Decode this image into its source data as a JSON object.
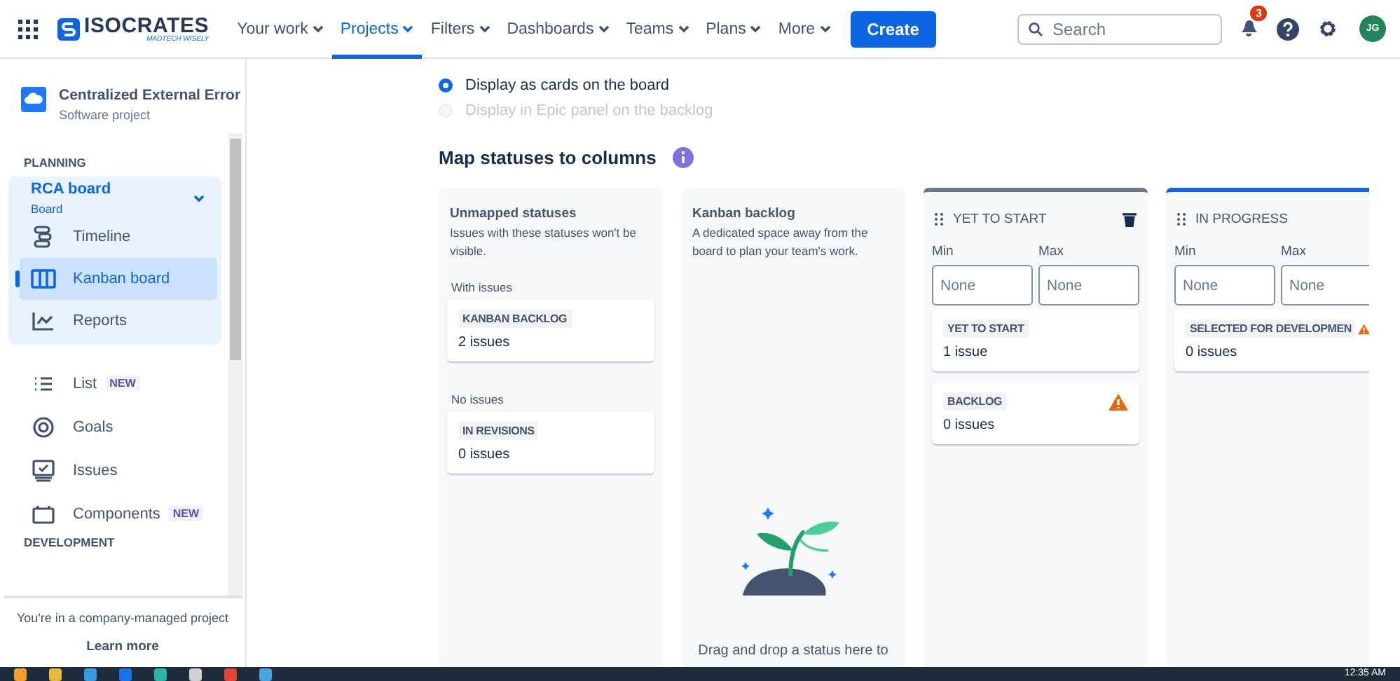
{
  "topbar": {
    "logo": {
      "name": "ISOCRATES",
      "tagline": "MADTECH WISELY"
    },
    "nav": [
      {
        "label": "Your work",
        "selected": false
      },
      {
        "label": "Projects",
        "selected": true
      },
      {
        "label": "Filters",
        "selected": false
      },
      {
        "label": "Dashboards",
        "selected": false
      },
      {
        "label": "Teams",
        "selected": false
      },
      {
        "label": "Plans",
        "selected": false
      },
      {
        "label": "More",
        "selected": false
      }
    ],
    "create_button": "Create",
    "search": {
      "placeholder": "Search"
    },
    "notifications": {
      "count": "3"
    },
    "avatar": "JG"
  },
  "sidebar": {
    "project": {
      "name": "Centralized External Error",
      "type": "Software project"
    },
    "sections": [
      {
        "title": "PLANNING",
        "items": [
          {
            "kind": "group",
            "label": "RCA board",
            "sublabel": "Board",
            "expanded": true,
            "children": [
              {
                "label": "Timeline",
                "selected": false
              },
              {
                "label": "Kanban board",
                "selected": true
              },
              {
                "label": "Reports",
                "selected": false
              }
            ]
          },
          {
            "kind": "item",
            "label": "List",
            "badge": "NEW"
          },
          {
            "kind": "item",
            "label": "Goals"
          },
          {
            "kind": "item",
            "label": "Issues"
          },
          {
            "kind": "item",
            "label": "Components",
            "badge": "NEW"
          }
        ]
      },
      {
        "title": "DEVELOPMENT"
      }
    ],
    "footer": {
      "text": "You're in a company-managed project",
      "link": "Learn more"
    }
  },
  "display_options": [
    {
      "label": "Display as cards on the board",
      "selected": true,
      "disabled": false
    },
    {
      "label": "Display in Epic panel on the backlog",
      "selected": false,
      "disabled": true
    }
  ],
  "board": {
    "title": "Map statuses to columns",
    "columns": [
      {
        "kind": "unmapped",
        "title": "Unmapped statuses",
        "description": "Issues with these statuses won't be visible.",
        "groups": [
          {
            "label": "With issues",
            "statuses": [
              {
                "name": "KANBAN BACKLOG",
                "count": "2 issues",
                "warning": false
              }
            ]
          },
          {
            "label": "No issues",
            "statuses": [
              {
                "name": "IN REVISIONS",
                "count": "0 issues",
                "warning": false
              }
            ]
          }
        ]
      },
      {
        "kind": "backlog",
        "title": "Kanban backlog",
        "description": "A dedicated space away from the board to plan your team's work.",
        "hint": "Drag and drop a status here to"
      },
      {
        "kind": "status",
        "title": "YET TO START",
        "color": "#6b778c",
        "deletable": true,
        "min": {
          "label": "Min",
          "placeholder": "None"
        },
        "max": {
          "label": "Max",
          "placeholder": "None"
        },
        "statuses": [
          {
            "name": "YET TO START",
            "count": "1 issue",
            "warning": false
          },
          {
            "name": "BACKLOG",
            "count": "0 issues",
            "warning": true
          }
        ]
      },
      {
        "kind": "status",
        "title": "IN PROGRESS",
        "color": "#0c66e4",
        "deletable": false,
        "min": {
          "label": "Min",
          "placeholder": "None"
        },
        "max": {
          "label": "Max",
          "placeholder": "None"
        },
        "statuses": [
          {
            "name": "SELECTED FOR DEVELOPMEN",
            "count": "0 issues",
            "warning": true
          }
        ]
      }
    ]
  },
  "taskbar": {
    "time": "12:35 AM"
  }
}
